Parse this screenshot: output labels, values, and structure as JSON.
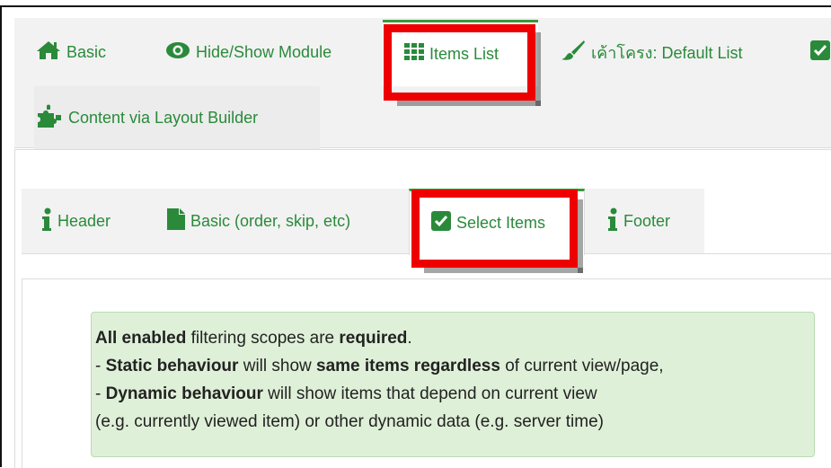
{
  "top_tabs": [
    {
      "label": "Basic",
      "icon": "home-icon",
      "active": false
    },
    {
      "label": "Hide/Show Module",
      "icon": "eye-icon",
      "active": false
    },
    {
      "label": "Items List",
      "icon": "grid-icon",
      "active": true
    },
    {
      "label": "เค้าโครง: Default List",
      "icon": "brush-icon",
      "active": false
    },
    {
      "label": "",
      "icon": "checkbox-icon",
      "active": false
    },
    {
      "label": "Content via Layout Builder",
      "icon": "puzzle-icon",
      "active": false
    }
  ],
  "sub_tabs": [
    {
      "label": "Header",
      "icon": "info-icon",
      "active": false
    },
    {
      "label": "Basic (order, skip, etc)",
      "icon": "file-icon",
      "active": false
    },
    {
      "label": "Select Items",
      "icon": "checkbox-icon",
      "active": true
    },
    {
      "label": "Footer",
      "icon": "info-icon",
      "active": false
    }
  ],
  "notice": {
    "line1": {
      "b1": "All enabled",
      "t1": " filtering scopes are ",
      "b2": "required",
      "t2": "."
    },
    "line2": {
      "t0": "- ",
      "b1": "Static behaviour",
      "t1": " will show ",
      "b2": "same items regardless",
      "t2": " of current view/page,"
    },
    "line3": {
      "t0": "- ",
      "b1": "Dynamic behaviour",
      "t1": " will show items that depend on current view"
    },
    "line4": "(e.g. currently viewed item) or other dynamic data (e.g. server time)"
  },
  "colors": {
    "accent_green": "#2a8a3a",
    "highlight_red": "#ee0000",
    "notice_bg": "#dff0d8",
    "tab_bar_bg": "#f2f2f2"
  }
}
